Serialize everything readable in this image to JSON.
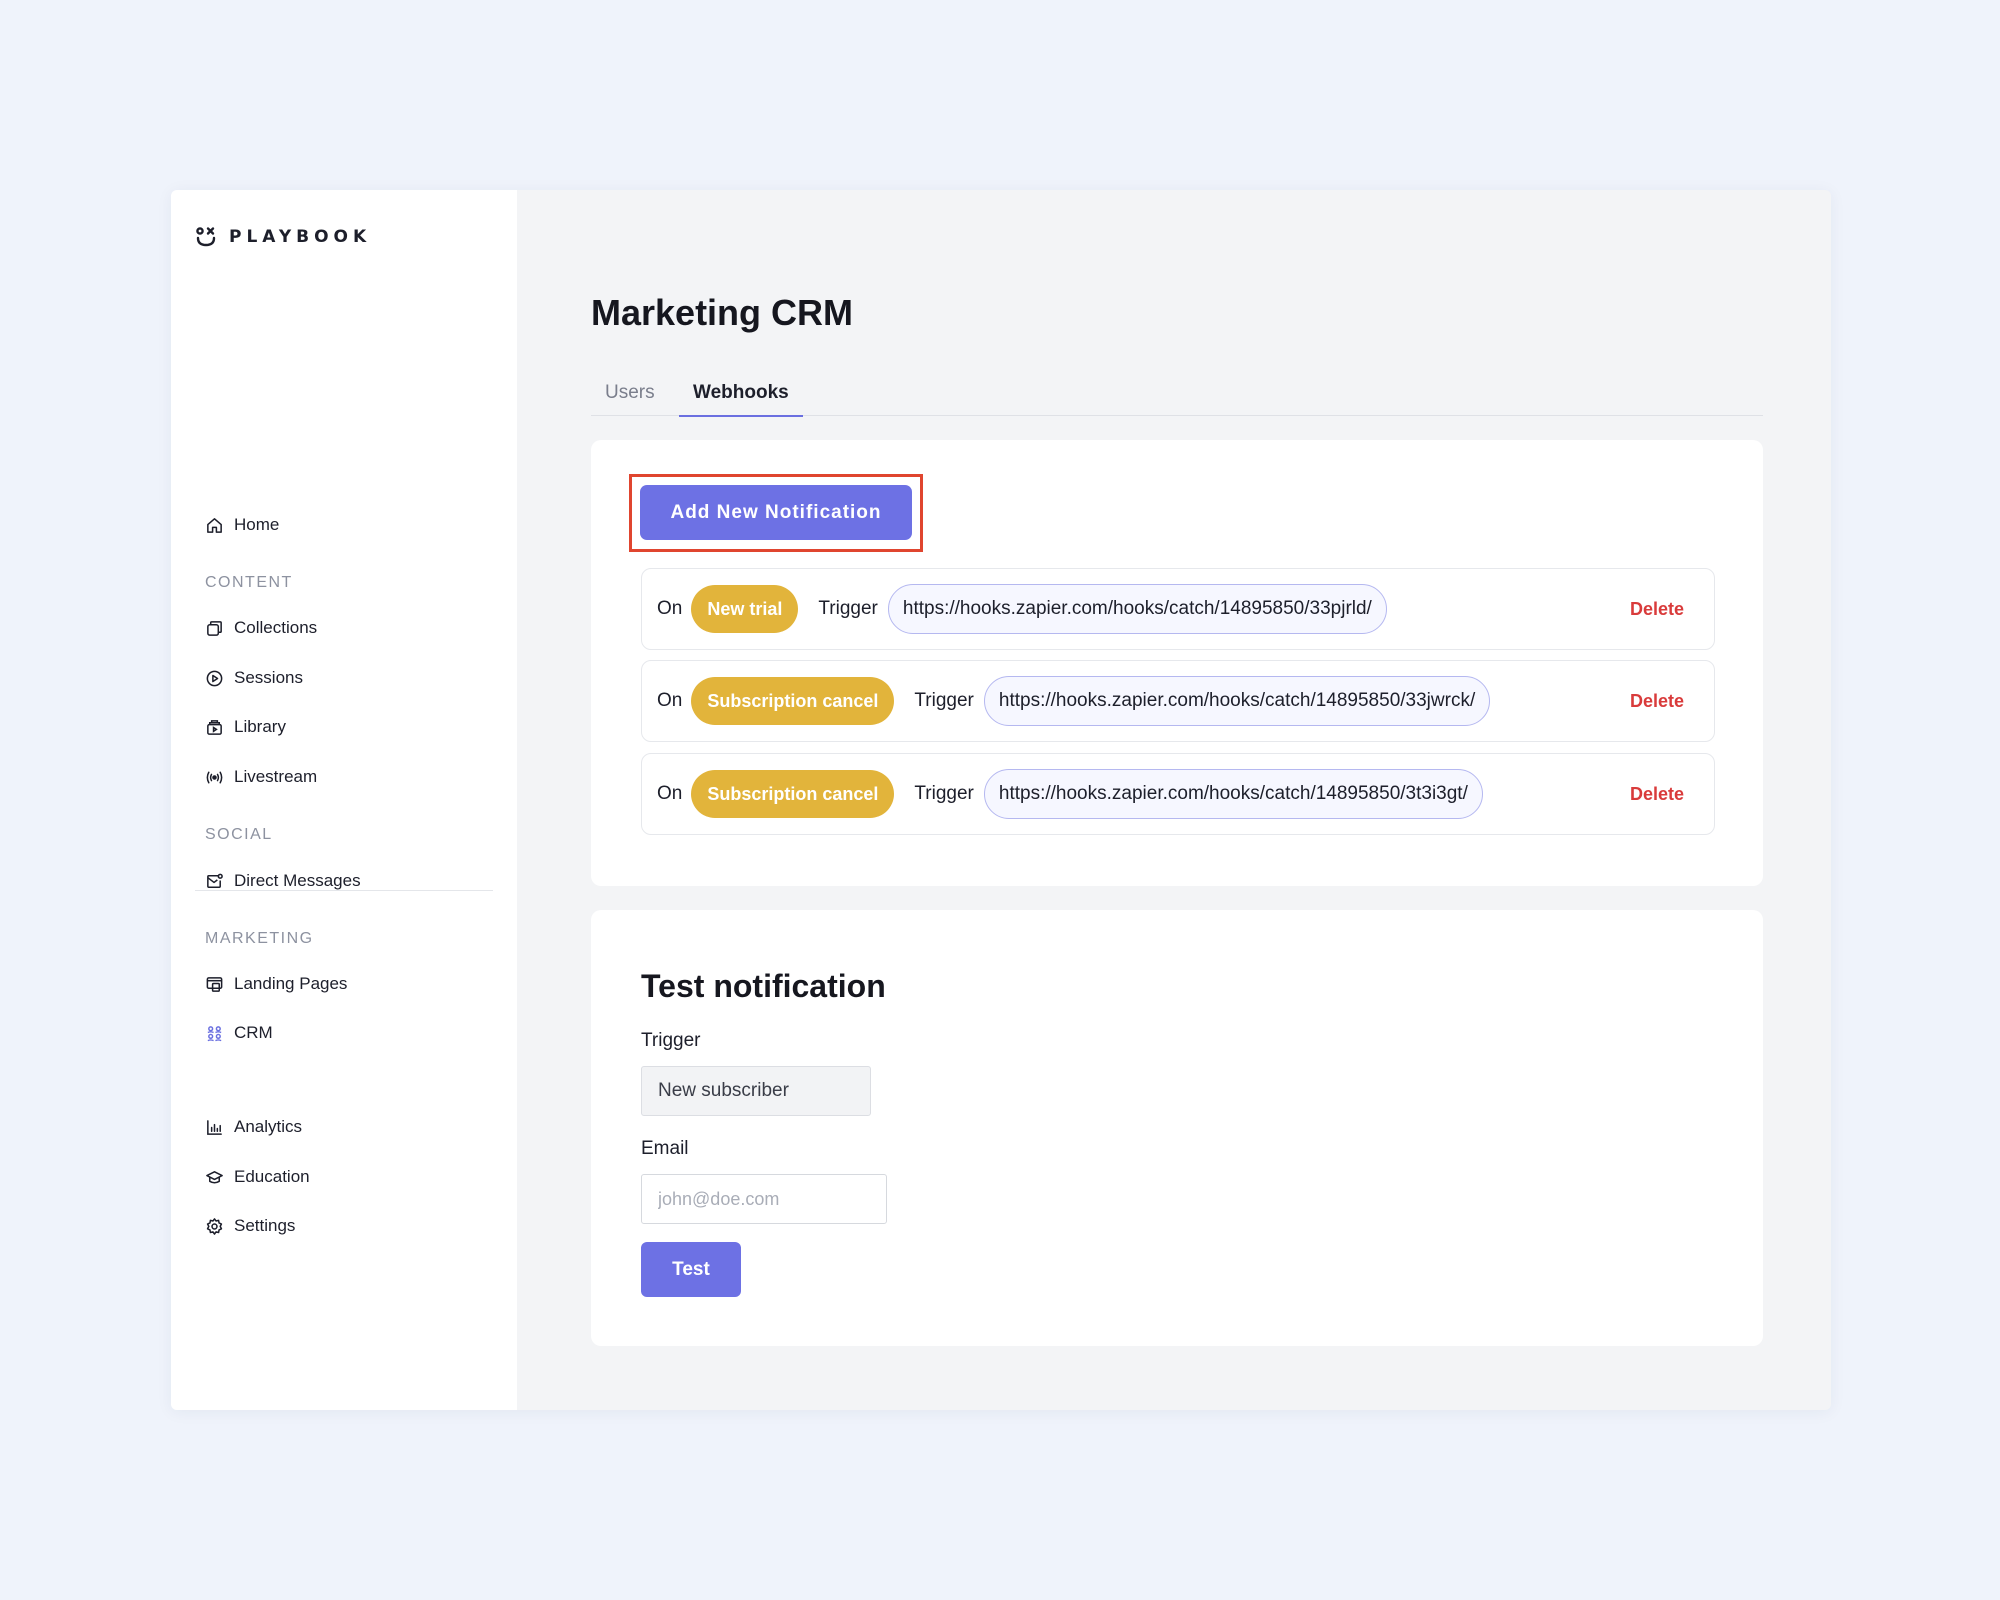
{
  "brand": {
    "name": "PLAYBOOK"
  },
  "sidebar": {
    "home": "Home",
    "sections": {
      "content": "CONTENT",
      "social": "SOCIAL",
      "marketing": "MARKETING"
    },
    "content_items": [
      "Collections",
      "Sessions",
      "Library",
      "Livestream"
    ],
    "social_items": [
      "Direct Messages"
    ],
    "marketing_items": [
      "Landing Pages",
      "CRM"
    ],
    "bottom_items": [
      "Analytics",
      "Education",
      "Settings"
    ],
    "active_item": "CRM"
  },
  "page": {
    "title": "Marketing CRM"
  },
  "tabs": [
    {
      "label": "Users",
      "active": false
    },
    {
      "label": "Webhooks",
      "active": true
    }
  ],
  "webhooks": {
    "add_button": "Add New Notification",
    "on_label": "On",
    "trigger_label": "Trigger",
    "delete_label": "Delete",
    "rows": [
      {
        "event": "New trial",
        "url": "https://hooks.zapier.com/hooks/catch/14895850/33pjrld/"
      },
      {
        "event": "Subscription cancel",
        "url": "https://hooks.zapier.com/hooks/catch/14895850/33jwrck/"
      },
      {
        "event": "Subscription cancel",
        "url": "https://hooks.zapier.com/hooks/catch/14895850/3t3i3gt/"
      }
    ]
  },
  "test": {
    "title": "Test notification",
    "trigger_label": "Trigger",
    "trigger_value": "New subscriber",
    "email_label": "Email",
    "email_placeholder": "john@doe.com",
    "button": "Test"
  },
  "colors": {
    "accent": "#6d71e4",
    "event_pill": "#e2b43b",
    "delete": "#d93b3b",
    "highlight_box": "#e0452f"
  }
}
